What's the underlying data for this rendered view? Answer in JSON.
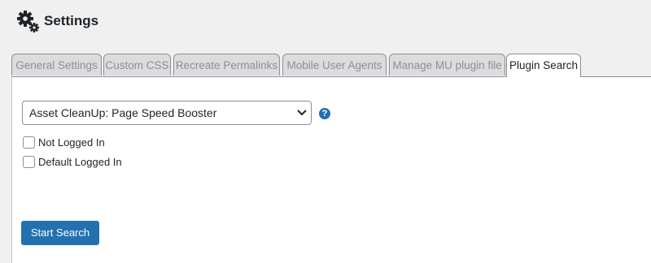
{
  "header": {
    "title": "Settings",
    "icon": "gears-icon"
  },
  "tabs": [
    {
      "label": "General Settings",
      "active": false
    },
    {
      "label": "Custom CSS",
      "active": false
    },
    {
      "label": "Recreate Permalinks",
      "active": false
    },
    {
      "label": "Mobile User Agents",
      "active": false
    },
    {
      "label": "Manage MU plugin file",
      "active": false
    },
    {
      "label": "Plugin Search",
      "active": true
    }
  ],
  "plugin_select": {
    "selected": "Asset CleanUp: Page Speed Booster"
  },
  "help_icon": {
    "glyph": "?"
  },
  "checkboxes": [
    {
      "label": "Not Logged In",
      "checked": false
    },
    {
      "label": "Default Logged In",
      "checked": false
    }
  ],
  "start_button": {
    "label": "Start Search"
  },
  "colors": {
    "accent": "#2271b1",
    "page_bg": "#f0f0f1",
    "tab_inactive_bg": "#dcdcde"
  }
}
